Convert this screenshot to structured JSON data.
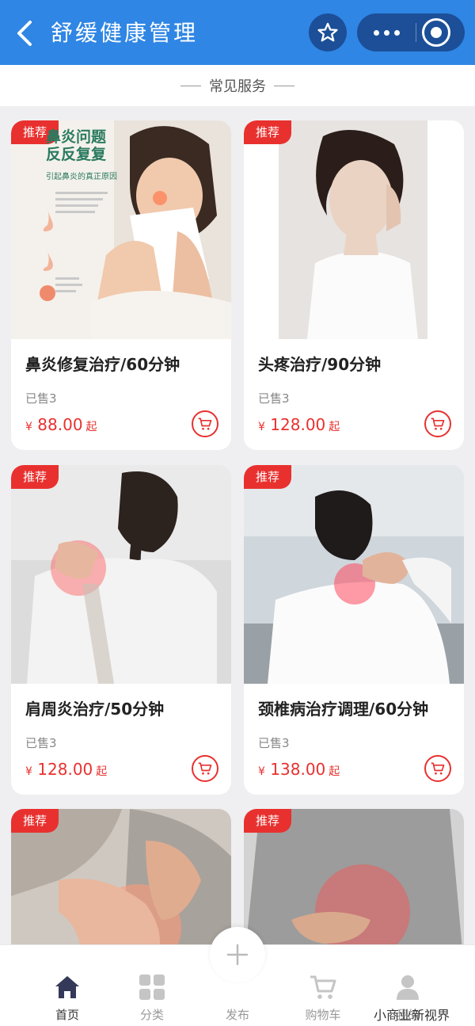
{
  "header": {
    "title": "舒缓健康管理",
    "back_icon": "back-arrow-icon",
    "star_icon": "star-icon",
    "more_icon": "more-dots-icon",
    "target_icon": "target-icon"
  },
  "section": {
    "title": "常见服务"
  },
  "cards": [
    {
      "badge": "推荐",
      "name": "鼻炎修复治疗/60分钟",
      "sold": "已售3",
      "currency": "¥",
      "price": "88.00",
      "suffix": "起",
      "poster_lines": [
        "鼻炎问题",
        "反反复复"
      ],
      "poster_sub": "引起鼻炎的真正原因"
    },
    {
      "badge": "推荐",
      "name": "头疼治疗/90分钟",
      "sold": "已售3",
      "currency": "¥",
      "price": "128.00",
      "suffix": "起"
    },
    {
      "badge": "推荐",
      "name": "肩周炎治疗/50分钟",
      "sold": "已售3",
      "currency": "¥",
      "price": "128.00",
      "suffix": "起"
    },
    {
      "badge": "推荐",
      "name": "颈椎病治疗调理/60分钟",
      "sold": "已售3",
      "currency": "¥",
      "price": "138.00",
      "suffix": "起"
    },
    {
      "badge": "推荐"
    },
    {
      "badge": "推荐"
    }
  ],
  "nav": [
    {
      "label": "首页",
      "icon": "home-icon"
    },
    {
      "label": "分类",
      "icon": "grid-icon"
    },
    {
      "label": "发布",
      "icon": "plus-icon"
    },
    {
      "label": "购物车",
      "icon": "cart-icon"
    },
    {
      "label": "我的",
      "icon": "user-icon"
    }
  ],
  "watermark": "小商业新视界",
  "colors": {
    "primary": "#2f86e4",
    "accent": "#e8312f",
    "capsule": "#1c4f98"
  }
}
